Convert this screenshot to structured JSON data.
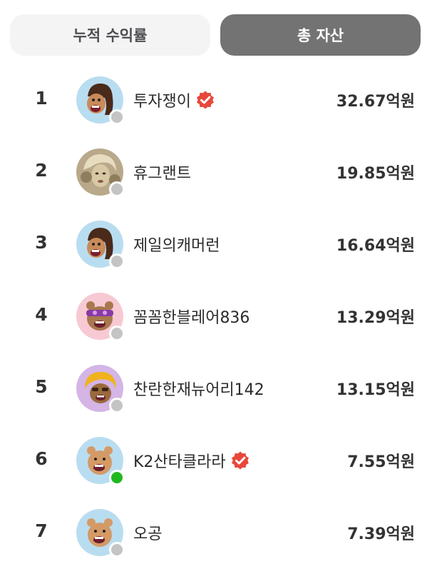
{
  "tabs": [
    {
      "label": "누적 수익률",
      "active": false
    },
    {
      "label": "총 자산",
      "active": true
    }
  ],
  "rows": [
    {
      "rank": "1",
      "name": "투자쟁이",
      "verified": true,
      "amount": "32.67억원",
      "online": false,
      "avatar": "bear-brown-hair",
      "avatar_bg": "#b9ddf0"
    },
    {
      "rank": "2",
      "name": "휴그랜트",
      "verified": false,
      "amount": "19.85억원",
      "online": false,
      "avatar": "photo-portrait",
      "avatar_bg": "#b9a98a"
    },
    {
      "rank": "3",
      "name": "제일의캐머런",
      "verified": false,
      "amount": "16.64억원",
      "online": false,
      "avatar": "bear-brown-hair",
      "avatar_bg": "#b9ddf0"
    },
    {
      "rank": "4",
      "name": "꼼꼼한블레어836",
      "verified": false,
      "amount": "13.29억원",
      "online": false,
      "avatar": "bear-purple-mask",
      "avatar_bg": "#f7c9d3"
    },
    {
      "rank": "5",
      "name": "찬란한재뉴어리142",
      "verified": false,
      "amount": "13.15억원",
      "online": false,
      "avatar": "bear-yellow-hair",
      "avatar_bg": "#d4b5e6"
    },
    {
      "rank": "6",
      "name": "K2산타클라라",
      "verified": true,
      "amount": "7.55억원",
      "online": true,
      "avatar": "bear-tan",
      "avatar_bg": "#b9ddf0"
    },
    {
      "rank": "7",
      "name": "오공",
      "verified": false,
      "amount": "7.39억원",
      "online": false,
      "avatar": "bear-tan",
      "avatar_bg": "#b9ddf0"
    }
  ],
  "colors": {
    "verified_badge": "#e8473b",
    "online_dot": "#1fb81f",
    "offline_dot": "#c4c4c4",
    "active_tab_bg": "#737373",
    "inactive_tab_bg": "#f4f4f5"
  }
}
